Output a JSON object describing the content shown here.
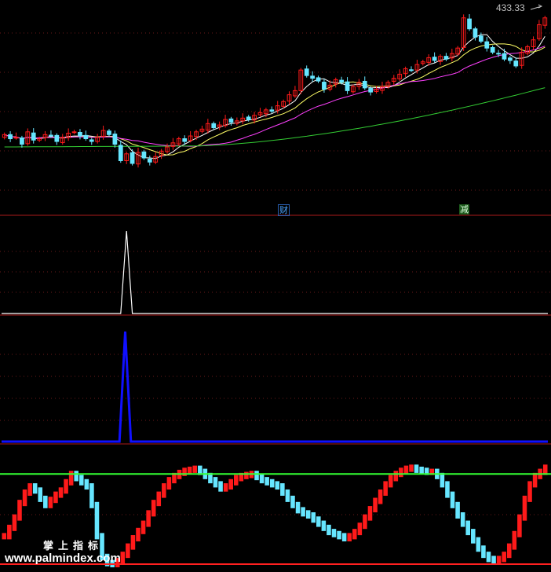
{
  "header": {
    "price_label": "433.33"
  },
  "signals": {
    "tag_left": "财",
    "tag_right": "减"
  },
  "watermark": {
    "brand": "掌上指标",
    "url": "www.palmindex.com"
  },
  "colors": {
    "background": "#000000",
    "up": "#ff1a1a",
    "down": "#66e6ff",
    "ma5": "#ffffff",
    "ma10": "#ffff66",
    "ma20": "#ff40ff",
    "ma60": "#33cc33",
    "panel_divider": "#aa1a1a",
    "spike_white": "#ffffff",
    "spike_blue": "#1010ff",
    "osc_upper_line": "#33ff33",
    "osc_lower_line": "#ff2020"
  },
  "chart_data": [
    {
      "type": "candlestick",
      "title": "",
      "price_label": "433.33",
      "closes": [
        345,
        342,
        343,
        338,
        347,
        341,
        342,
        345,
        344,
        340,
        343,
        346,
        347,
        344,
        342,
        340,
        343,
        348,
        345,
        338,
        326,
        331,
        324,
        332,
        328,
        325,
        329,
        333,
        336,
        339,
        342,
        340,
        344,
        347,
        349,
        353,
        350,
        352,
        356,
        354,
        355,
        357,
        356,
        359,
        361,
        363,
        362,
        366,
        369,
        374,
        377,
        392,
        388,
        386,
        384,
        378,
        381,
        385,
        383,
        377,
        380,
        383,
        379,
        376,
        378,
        380,
        383,
        386,
        389,
        393,
        392,
        396,
        398,
        401,
        399,
        402,
        400,
        404,
        408,
        430,
        422,
        416,
        413,
        408,
        405,
        404,
        400,
        399,
        395,
        405,
        409,
        414,
        425,
        430
      ],
      "ma_lines": [
        "MA5",
        "MA10",
        "MA20",
        "MA60"
      ]
    },
    {
      "type": "line",
      "title": "",
      "series": [
        {
          "values": [
            0,
            0,
            0,
            0,
            0,
            0,
            0,
            0,
            0,
            0,
            0,
            0,
            0,
            0,
            0,
            0,
            0,
            0,
            0,
            0,
            0,
            1,
            0,
            0,
            0,
            0,
            0,
            0,
            0,
            0,
            0,
            0,
            0,
            0,
            0,
            0,
            0,
            0,
            0,
            0,
            0,
            0,
            0,
            0,
            0,
            0,
            0,
            0,
            0,
            0,
            0,
            0,
            0,
            0,
            0,
            0,
            0,
            0,
            0,
            0,
            0,
            0,
            0,
            0,
            0,
            0,
            0,
            0,
            0,
            0,
            0,
            0,
            0,
            0,
            0,
            0,
            0,
            0,
            0,
            0,
            0,
            0,
            0,
            0,
            0,
            0,
            0,
            0,
            0,
            0,
            0,
            0,
            0,
            0
          ]
        }
      ]
    },
    {
      "type": "line",
      "title": "",
      "series": [
        {
          "values": [
            0,
            0,
            0,
            0,
            0,
            0,
            0,
            0,
            0,
            0,
            0,
            0,
            0,
            0,
            0,
            0,
            0,
            0,
            0,
            0,
            0,
            1,
            0,
            0,
            0,
            0,
            0,
            0,
            0,
            0,
            0,
            0,
            0,
            0,
            0,
            0,
            0,
            0,
            0,
            0,
            0,
            0,
            0,
            0,
            0,
            0,
            0,
            0,
            0,
            0,
            0,
            0,
            0,
            0,
            0,
            0,
            0,
            0,
            0,
            0,
            0,
            0,
            0,
            0,
            0,
            0,
            0,
            0,
            0,
            0,
            0,
            0,
            0,
            0,
            0,
            0,
            0,
            0,
            0,
            0,
            0,
            0,
            0,
            0,
            0,
            0,
            0,
            0,
            0,
            0,
            0,
            0,
            0,
            0,
            0
          ]
        }
      ]
    },
    {
      "type": "bar",
      "title": "",
      "ylim": [
        0,
        100
      ],
      "reference_lines": [
        90,
        3
      ],
      "values": [
        30,
        38,
        48,
        62,
        72,
        78,
        74,
        66,
        60,
        65,
        70,
        74,
        82,
        90,
        86,
        82,
        78,
        60,
        30,
        10,
        4,
        3,
        6,
        12,
        20,
        28,
        35,
        42,
        52,
        62,
        70,
        78,
        84,
        88,
        91,
        93,
        94,
        95,
        92,
        88,
        84,
        80,
        76,
        78,
        82,
        86,
        88,
        89,
        90,
        87,
        84,
        82,
        80,
        78,
        72,
        66,
        60,
        55,
        52,
        50,
        46,
        42,
        38,
        34,
        32,
        30,
        28,
        30,
        34,
        40,
        48,
        56,
        64,
        72,
        80,
        86,
        90,
        93,
        95,
        96,
        94,
        93,
        92,
        92,
        88,
        80,
        70,
        60,
        50,
        42,
        34,
        26,
        18,
        12,
        8,
        6,
        8,
        12,
        20,
        32,
        48,
        66,
        80,
        88,
        92,
        96
      ]
    }
  ]
}
